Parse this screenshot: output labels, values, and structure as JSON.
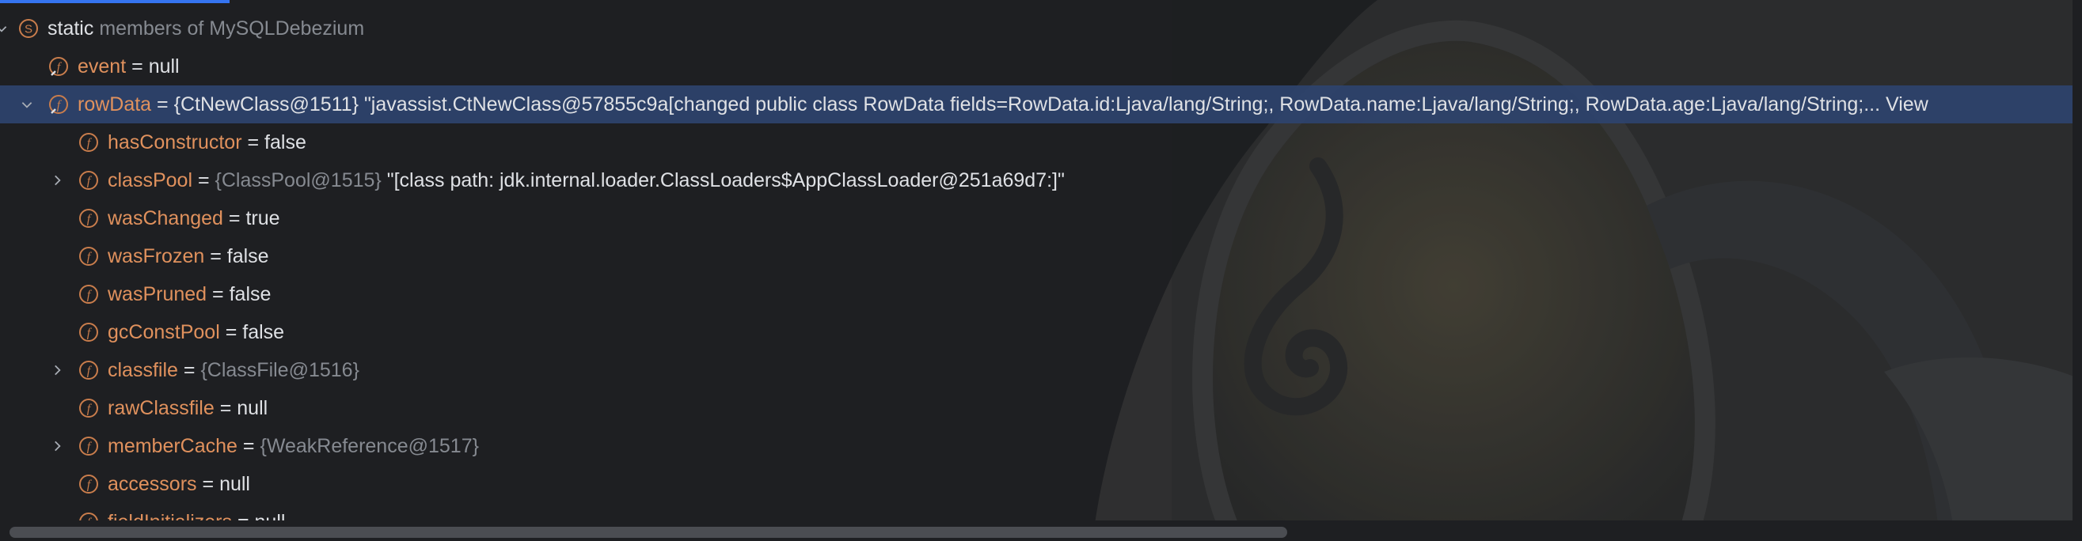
{
  "tree": {
    "static_row": {
      "keyword": "static",
      "suffix": "members of MySQLDebezium"
    },
    "rows": [
      {
        "name": "event",
        "eq": "=",
        "value": "null"
      },
      {
        "name": "rowData",
        "eq": "=",
        "type": "{CtNewClass@1511}",
        "value": "\"javassist.CtNewClass@57855c9a[changed public class RowData fields=RowData.id:Ljava/lang/String;, RowData.name:Ljava/lang/String;, RowData.age:Ljava/lang/String;...",
        "view_link": "View"
      },
      {
        "name": "hasConstructor",
        "eq": "=",
        "value": "false"
      },
      {
        "name": "classPool",
        "eq": "=",
        "type": "{ClassPool@1515}",
        "value": "\"[class path: jdk.internal.loader.ClassLoaders$AppClassLoader@251a69d7:]\""
      },
      {
        "name": "wasChanged",
        "eq": "=",
        "value": "true"
      },
      {
        "name": "wasFrozen",
        "eq": "=",
        "value": "false"
      },
      {
        "name": "wasPruned",
        "eq": "=",
        "value": "false"
      },
      {
        "name": "gcConstPool",
        "eq": "=",
        "value": "false"
      },
      {
        "name": "classfile",
        "eq": "=",
        "type": "{ClassFile@1516}"
      },
      {
        "name": "rawClassfile",
        "eq": "=",
        "value": "null"
      },
      {
        "name": "memberCache",
        "eq": "=",
        "type": "{WeakReference@1517}"
      },
      {
        "name": "accessors",
        "eq": "=",
        "value": "null"
      },
      {
        "name": "fieldInitializers",
        "eq": "=",
        "value": "null"
      }
    ]
  },
  "colors": {
    "background": "#1e1f22",
    "selection": "#2e436e",
    "field_name": "#e0915d",
    "type_ref": "#868a91",
    "accent": "#3574f0"
  },
  "icons": {
    "static_group": "static-s-icon",
    "static_field": "static-field-icon",
    "field": "field-f-icon",
    "expand": "chevron-right-icon",
    "collapse": "chevron-down-icon"
  }
}
